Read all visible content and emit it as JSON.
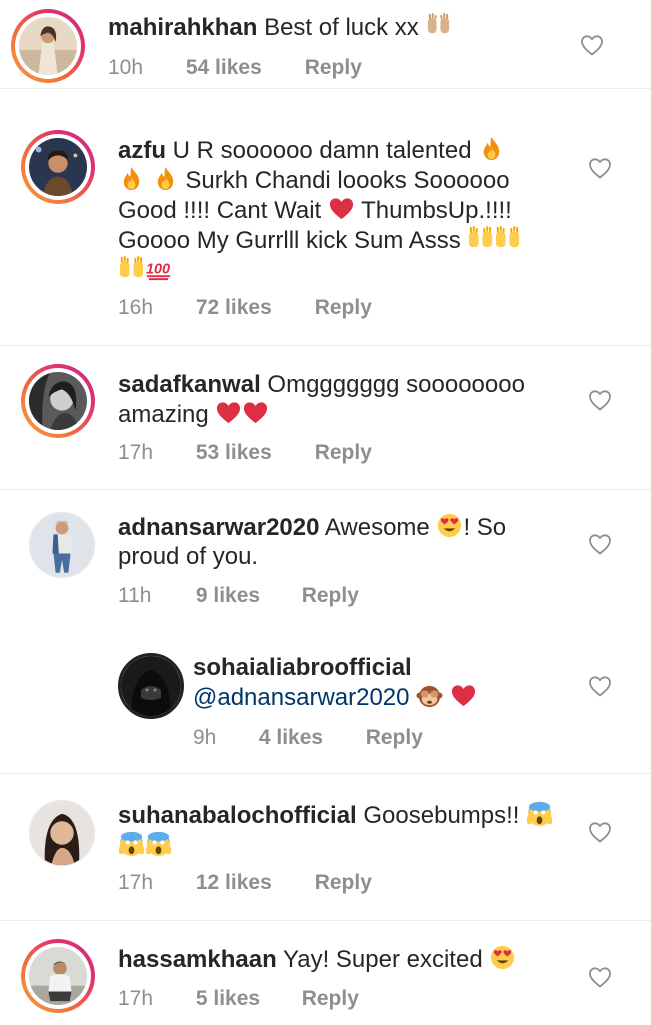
{
  "comments": [
    {
      "username": "mahirahkhan",
      "body": "Best of luck xx",
      "time": "10h",
      "likes": "54 likes",
      "reply": "Reply"
    },
    {
      "username": "azfu",
      "body_1": "U R soooooo damn talented",
      "body_2": "Surkh Chandi loooks Soooooo",
      "body_3": "Good !!!! Cant Wait",
      "body_3b": "ThumbsUp.!!!!",
      "body_4": "Goooo My Gurrlll kick Sum Asss",
      "time": "16h",
      "likes": "72 likes",
      "reply": "Reply"
    },
    {
      "username": "sadafkanwal",
      "body_1": "Omggggggg soooooooo",
      "body_2": "amazing",
      "time": "17h",
      "likes": "53 likes",
      "reply": "Reply"
    },
    {
      "username": "adnansarwar2020",
      "body_1": "Awesome",
      "body_1b": "! So",
      "body_2": "proud of you.",
      "time": "11h",
      "likes": "9 likes",
      "reply": "Reply"
    },
    {
      "username": "sohaialiabroofficial",
      "mention": "@adnansarwar2020",
      "time": "9h",
      "likes": "4 likes",
      "reply": "Reply"
    },
    {
      "username": "suhanabalochofficial",
      "body": "Goosebumps!!",
      "time": "17h",
      "likes": "12 likes",
      "reply": "Reply"
    },
    {
      "username": "hassamkhaan",
      "body": "Yay! Super excited",
      "time": "17h",
      "likes": "5 likes",
      "reply": "Reply"
    }
  ],
  "icons": {
    "like": "heart-outline-icon"
  },
  "colors": {
    "text": "#262626",
    "meta": "#8e8e8e",
    "mention": "#003569",
    "heart_emoji": "#e0212f",
    "story_ring": "#e2336b"
  }
}
